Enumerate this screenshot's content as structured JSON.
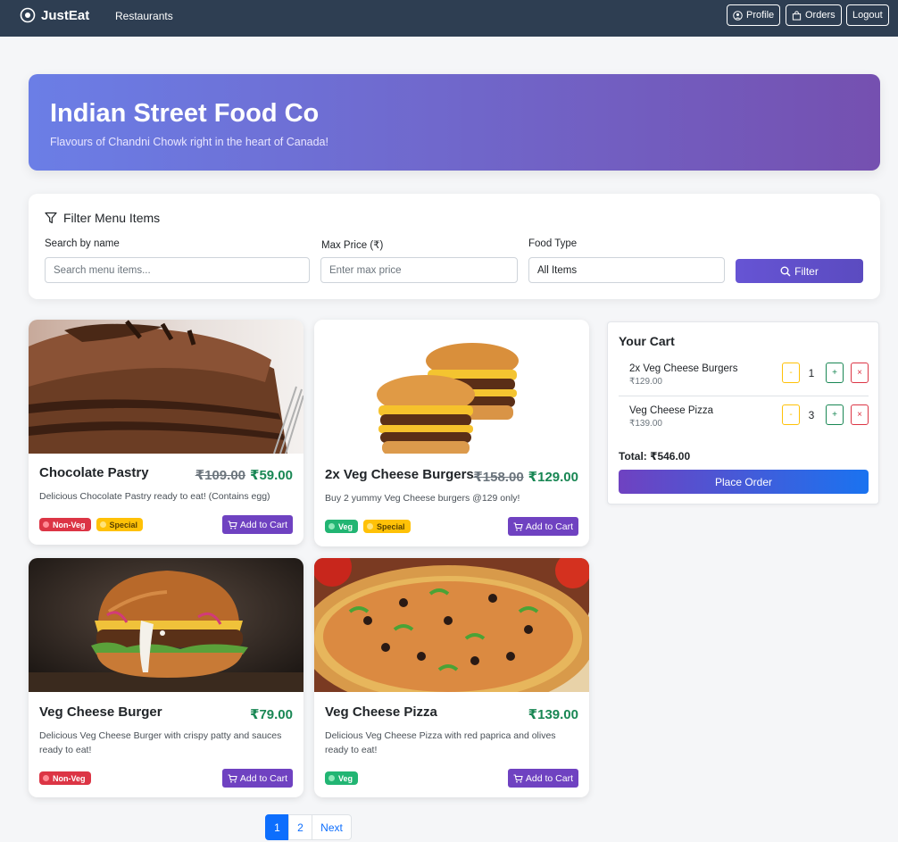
{
  "navbar": {
    "brand": "JustEat",
    "nav_link": "Restaurants",
    "profile_label": "Profile",
    "orders_label": "Orders",
    "logout_label": "Logout"
  },
  "hero": {
    "title": "Indian Street Food Co",
    "subtitle": "Flavours of Chandni Chowk right in the heart of Canada!"
  },
  "filter": {
    "title": "Filter Menu Items",
    "search_label": "Search by name",
    "search_placeholder": "Search menu items...",
    "price_label": "Max Price (₹)",
    "price_placeholder": "Enter max price",
    "type_label": "Food Type",
    "type_value": "All Items",
    "button_label": "Filter"
  },
  "menu": {
    "add_label": "Add to Cart",
    "items": [
      {
        "name": "Chocolate Pastry",
        "old_price": "₹109.00",
        "price": "₹59.00",
        "description": "Delicious Chocolate Pastry ready to eat! (Contains egg)",
        "badges": [
          "Non-Veg",
          "Special"
        ]
      },
      {
        "name": "2x Veg Cheese Burgers",
        "old_price": "₹158.00",
        "price": "₹129.00",
        "description": "Buy 2 yummy Veg Cheese burgers @129 only!",
        "badges": [
          "Veg",
          "Special"
        ]
      },
      {
        "name": "Veg Cheese Burger",
        "price": "₹79.00",
        "description": "Delicious Veg Cheese Burger with crispy patty and sauces ready to eat!",
        "badges": [
          "Non-Veg"
        ]
      },
      {
        "name": "Veg Cheese Pizza",
        "price": "₹139.00",
        "description": "Delicious Veg Cheese Pizza with red paprica and olives ready to eat!",
        "badges": [
          "Veg"
        ]
      }
    ]
  },
  "cart": {
    "title": "Your Cart",
    "items": [
      {
        "name": "2x Veg Cheese Burgers",
        "price": "₹129.00",
        "qty": "1"
      },
      {
        "name": "Veg Cheese Pizza",
        "price": "₹139.00",
        "qty": "3"
      }
    ],
    "minus": "-",
    "plus": "+",
    "remove": "×",
    "total": "Total: ₹546.00",
    "order_label": "Place Order"
  },
  "pagination": {
    "pages": [
      "1",
      "2"
    ],
    "next_label": "Next"
  },
  "colors": {
    "navbar": "#2e3e52",
    "hero_start": "#6b7ee6",
    "hero_end": "#7550b0",
    "accent_purple": "#6f42c1",
    "accent_blue": "#0d6efd",
    "price_green": "#198754"
  }
}
